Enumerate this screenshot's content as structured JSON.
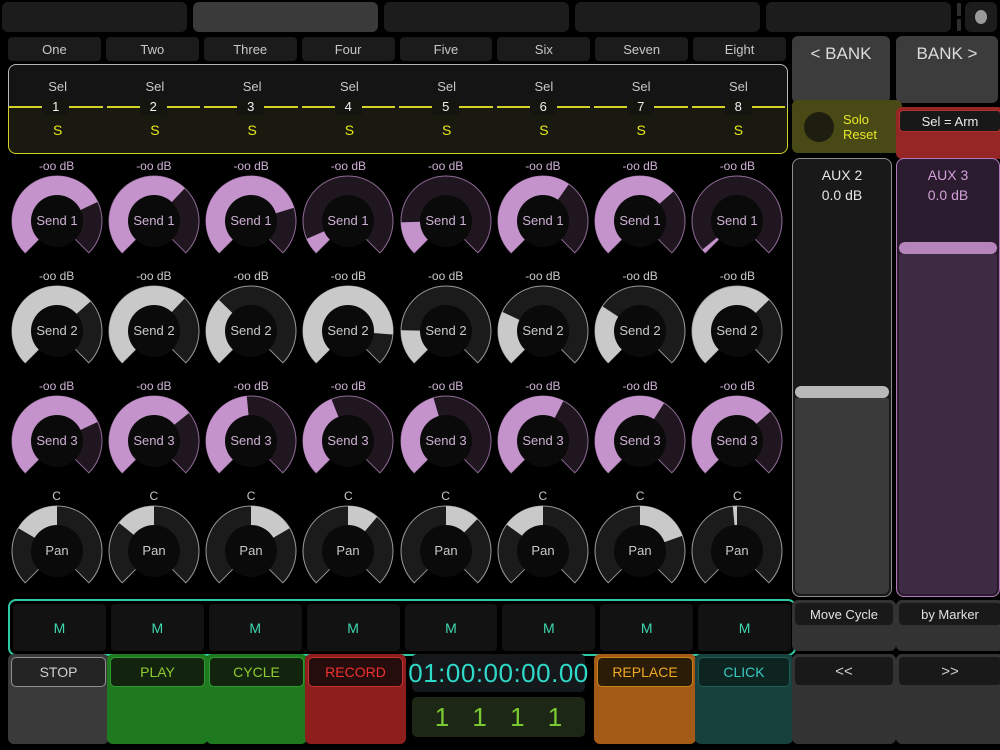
{
  "topbar": {
    "tabs": [
      "",
      "",
      "",
      "",
      ""
    ],
    "selected_index": 1
  },
  "mixer": {
    "track_names": [
      "One",
      "Two",
      "Three",
      "Four",
      "Five",
      "Six",
      "Seven",
      "Eight"
    ],
    "select_label": "Sel",
    "channel_numbers": [
      "1",
      "2",
      "3",
      "4",
      "5",
      "6",
      "7",
      "8"
    ],
    "solo_label": "S",
    "mute_label": "M",
    "send_rows": [
      {
        "name": "Send 1",
        "value_label": "-oo dB",
        "style": "pink",
        "values": [
          0.74,
          0.66,
          0.77,
          0.08,
          0.16,
          0.63,
          0.68,
          0.02
        ]
      },
      {
        "name": "Send 2",
        "value_label": "-oo dB",
        "style": "gray",
        "values": [
          0.68,
          0.66,
          0.33,
          0.85,
          0.17,
          0.26,
          0.29,
          0.67
        ]
      },
      {
        "name": "Send 3",
        "value_label": "-oo dB",
        "style": "pink",
        "values": [
          0.74,
          0.69,
          0.48,
          0.42,
          0.44,
          0.6,
          0.62,
          0.68
        ]
      }
    ],
    "pan_row": {
      "name": "Pan",
      "value_label": "C",
      "style": "gray",
      "values": [
        -0.44,
        -0.38,
        0.44,
        0.3,
        0.33,
        -0.4,
        0.52,
        -0.04
      ]
    }
  },
  "transport": {
    "stop": "STOP",
    "play": "PLAY",
    "cycle": "CYCLE",
    "record": "RECORD",
    "timecode": "01:00:00:00.00",
    "bars": "1 1 1 1",
    "replace": "REPLACE",
    "click": "CLICK"
  },
  "right_panel": {
    "bank_prev": "< BANK",
    "bank_next": "BANK >",
    "solo_reset_line1": "Solo",
    "solo_reset_line2": "Reset",
    "sel_arm": "Sel = Arm",
    "faders": [
      {
        "name": "AUX 2",
        "db": "0.0 dB",
        "style": "gray",
        "handle": 0.52
      },
      {
        "name": "AUX 3",
        "db": "0.0 dB",
        "style": "purple",
        "handle": 0.19
      }
    ],
    "move_cycle": "Move Cycle",
    "by_marker": "by Marker",
    "rewind": "<<",
    "forward": ">>"
  },
  "colors": {
    "knob_pink": "#c493cb",
    "knob_gray": "#c9c9c9",
    "solo_yellow": "#e8e818",
    "mute_teal": "#3fd9ae",
    "timecode_cyan": "#2fd8c8",
    "bars_green": "#7ac832"
  }
}
